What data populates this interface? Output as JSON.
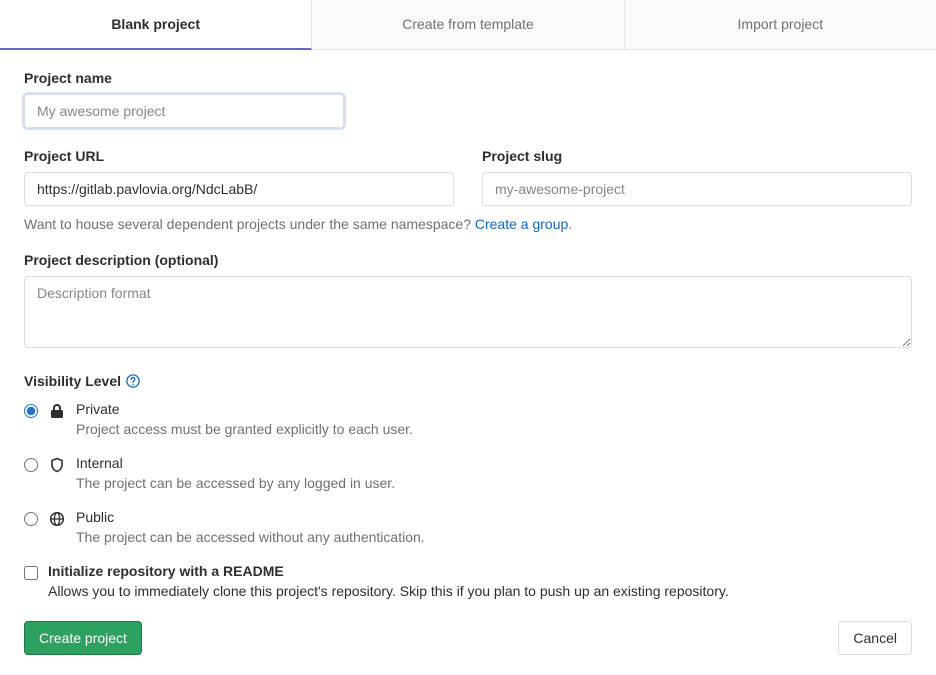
{
  "tabs": {
    "blank": "Blank project",
    "template": "Create from template",
    "import": "Import project"
  },
  "form": {
    "name_label": "Project name",
    "name_placeholder": "My awesome project",
    "name_value": "",
    "url_label": "Project URL",
    "url_value": "https://gitlab.pavlovia.org/NdcLabB/",
    "slug_label": "Project slug",
    "slug_placeholder": "my-awesome-project",
    "slug_value": "",
    "hint_text": "Want to house several dependent projects under the same namespace? ",
    "hint_link": "Create a group",
    "hint_period": ".",
    "desc_label": "Project description (optional)",
    "desc_placeholder": "Description format",
    "desc_value": ""
  },
  "visibility": {
    "heading": "Visibility Level",
    "options": {
      "private": {
        "title": "Private",
        "desc": "Project access must be granted explicitly to each user."
      },
      "internal": {
        "title": "Internal",
        "desc": "The project can be accessed by any logged in user."
      },
      "public": {
        "title": "Public",
        "desc": "The project can be accessed without any authentication."
      }
    }
  },
  "readme": {
    "title": "Initialize repository with a README",
    "desc": "Allows you to immediately clone this project's repository. Skip this if you plan to push up an existing repository."
  },
  "actions": {
    "create": "Create project",
    "cancel": "Cancel"
  }
}
